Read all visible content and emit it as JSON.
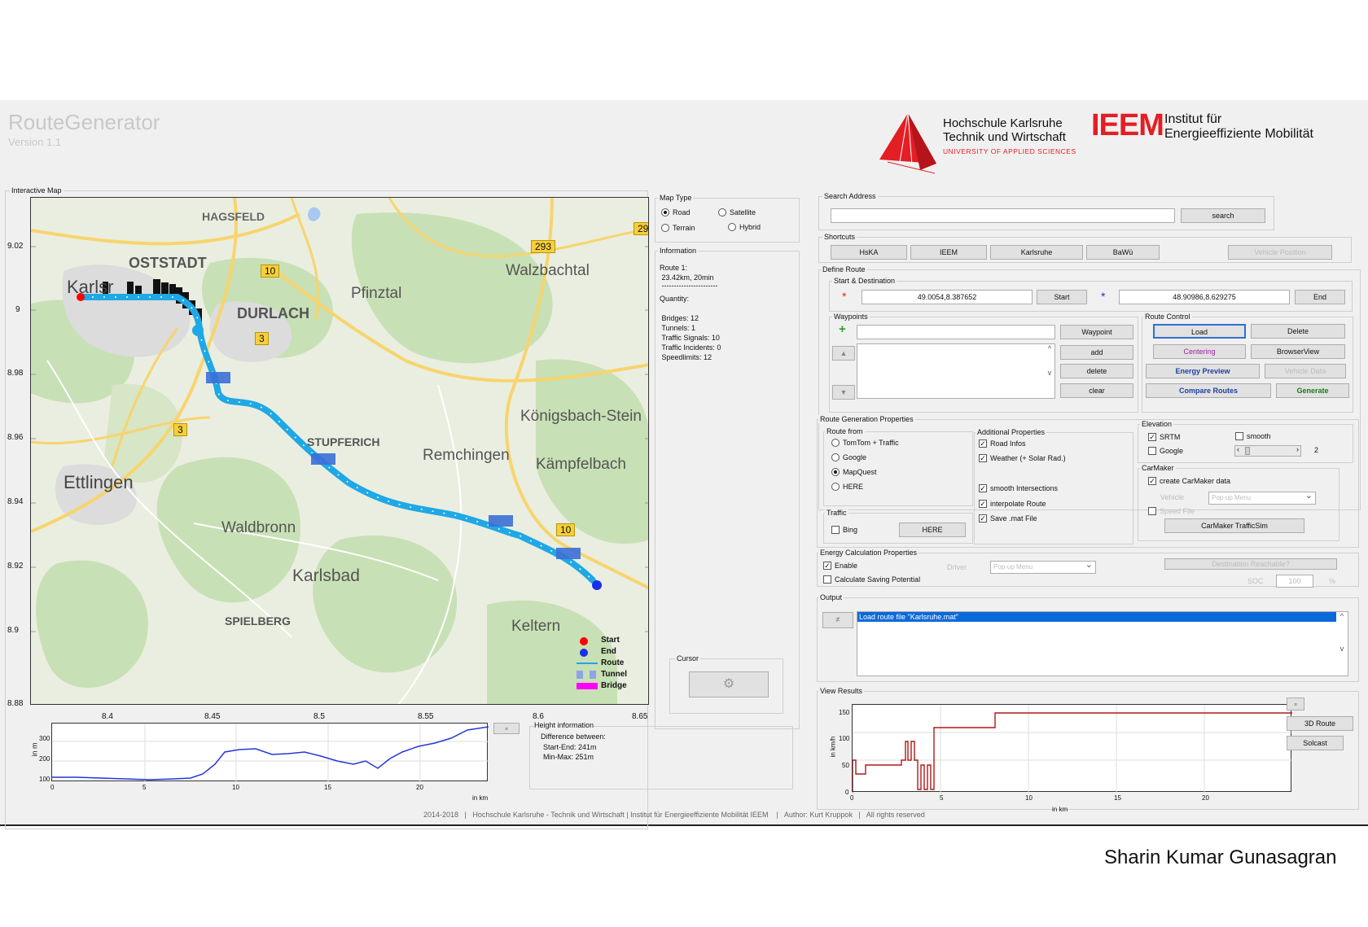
{
  "app": {
    "title": "RouteGenerator",
    "version": "Version 1.1"
  },
  "logos": {
    "hs_line1": "Hochschule Karlsruhe",
    "hs_line2": "Technik und Wirtschaft",
    "hs_line3": "UNIVERSITY OF APPLIED SCIENCES",
    "ieem": "IEEM",
    "ieem_line1": "Institut  für",
    "ieem_line2": "Energieeffiziente Mobilität"
  },
  "map": {
    "label": "Interactive Map",
    "yticks": [
      "9.02",
      "9",
      "8.98",
      "8.96",
      "8.94",
      "8.92",
      "8.9",
      "8.88"
    ],
    "xticks": [
      "8.4",
      "8.45",
      "8.5",
      "8.55",
      "8.6",
      "8.65"
    ],
    "places": [
      "HAGSFELD",
      "OSTSTADT",
      "DURLACH",
      "Pfinztal",
      "Walzbachtal",
      "STUPFERICH",
      "Remchingen",
      "Königsbach-Stein",
      "Kämpfelbach",
      "Ettlingen",
      "Waldbronn",
      "Karlsbad",
      "SPIELBERG",
      "Keltern",
      "Karlsr"
    ],
    "roads": [
      "10",
      "3",
      "3",
      "293",
      "10",
      "29"
    ],
    "legend": [
      "Start",
      "End",
      "Route",
      "Tunnel",
      "Bridge"
    ],
    "colors": {
      "route": "#1fa8e6",
      "start": "#ff0000",
      "end": "#1a2fe8",
      "tunnel": "#3a6fd6",
      "bridge": "#ff00ff"
    }
  },
  "map_type": {
    "label": "Map Type",
    "options": [
      {
        "label": "Road",
        "selected": true
      },
      {
        "label": "Satellite",
        "selected": false
      },
      {
        "label": "Terrain",
        "selected": false
      },
      {
        "label": "Hybrid",
        "selected": false
      }
    ]
  },
  "information": {
    "label": "Information",
    "route_line1": "Route 1:",
    "route_line2": " 23.42km, 20min",
    "separator": " -----------------------",
    "quantity": "Quantity:",
    "bridges": " Bridges: 12",
    "tunnels": " Tunnels: 1",
    "signals": " Traffic Signals: 10",
    "incidents": " Traffic Incidents: 0",
    "speedlimits": " Speedlimits: 12"
  },
  "cursor": {
    "label": "Cursor",
    "icon": "crosshair-icon"
  },
  "height_plot": {
    "ylabel": "in m",
    "xlabel": "in km",
    "yticks": [
      "300",
      "200",
      "100"
    ],
    "xticks": [
      "0",
      "5",
      "10",
      "15",
      "20"
    ]
  },
  "height_info": {
    "title": "Height information",
    "line1": "Difference between:",
    "line2": "Start-End: 241m",
    "line3": "Min-Max: 251m"
  },
  "search": {
    "label": "Search Address",
    "value": "",
    "button": "search"
  },
  "shortcuts": {
    "label": "Shortcuts",
    "items": [
      "HsKA",
      "IEEM",
      "Karlsruhe",
      "BaWü"
    ],
    "vehicle_position": "Vehicle Position"
  },
  "define_route": {
    "label": "Define Route",
    "start_dest_label": "Start & Destination",
    "start_value": "49.0054,8.387652",
    "start_button": "Start",
    "end_value": "48.90986,8.629275",
    "end_button": "End",
    "waypoints_label": "Waypoints",
    "waypoint_button": "Waypoint",
    "add": "add",
    "delete": "delete",
    "clear": "clear"
  },
  "route_control": {
    "label": "Route Control",
    "load": "Load",
    "delete": "Delete",
    "centering": "Centering",
    "browserview": "BrowserView",
    "energy_preview": "Energy Preview",
    "vehicle_data": "Vehicle Data",
    "compare_routes": "Compare Routes",
    "generate": "Generate"
  },
  "route_gen": {
    "label": "Route Generation Properties",
    "route_from_label": "Route from",
    "route_from": [
      {
        "label": "TomTom + Traffic",
        "selected": false
      },
      {
        "label": "Google",
        "selected": false
      },
      {
        "label": "MapQuest",
        "selected": true
      },
      {
        "label": "HERE",
        "selected": false
      }
    ],
    "additional_label": "Additional Properties",
    "road_infos": "Road Infos",
    "weather": "Weather (+ Solar Rad.)",
    "smooth_intersections": "smooth Intersections",
    "interpolate": "interpolate Route",
    "save_mat": "Save .mat File",
    "traffic_label": "Traffic",
    "bing": "Bing",
    "here_button": "HERE",
    "elevation_label": "Elevation",
    "srtm": "SRTM",
    "google": "Google",
    "smooth": "smooth",
    "smooth_value": "2",
    "carmaker_label": "CarMaker",
    "create_carmaker": "create CarMaker data",
    "vehicle": "Vehicle",
    "popup": "Pop-up Menu",
    "speed_file": "Speed File",
    "trafficsim": "CarMaker TrafficSim"
  },
  "energy": {
    "label": "Energy Calculation Properties",
    "enable": "Enable",
    "saving": "Calculate Saving Potential",
    "driver": "Driver",
    "popup": "Pop-up Menu",
    "destination": "Destination Reachable?",
    "soc": "SOC",
    "soc_value": "100",
    "percent": "%"
  },
  "output": {
    "label": "Output",
    "line": "Load route file \"Karlsruhe.mat\""
  },
  "view_results": {
    "label": "View Results",
    "ylabel": "in km/h",
    "xlabel": "in km",
    "yticks": [
      "150",
      "100",
      "50",
      "0"
    ],
    "xticks": [
      "0",
      "5",
      "10",
      "15",
      "20"
    ],
    "btn_3d": "3D Route",
    "btn_solcast": "Solcast"
  },
  "footer": "2014-2018   |   Hochschule Karlsruhe - Technik und Wirtschaft | Institut für Energieeffiziente Mobilität IEEM    |   Author: Kurt Kruppok   |   All rights reserved",
  "credit": "Sharin Kumar Gunasagran"
}
